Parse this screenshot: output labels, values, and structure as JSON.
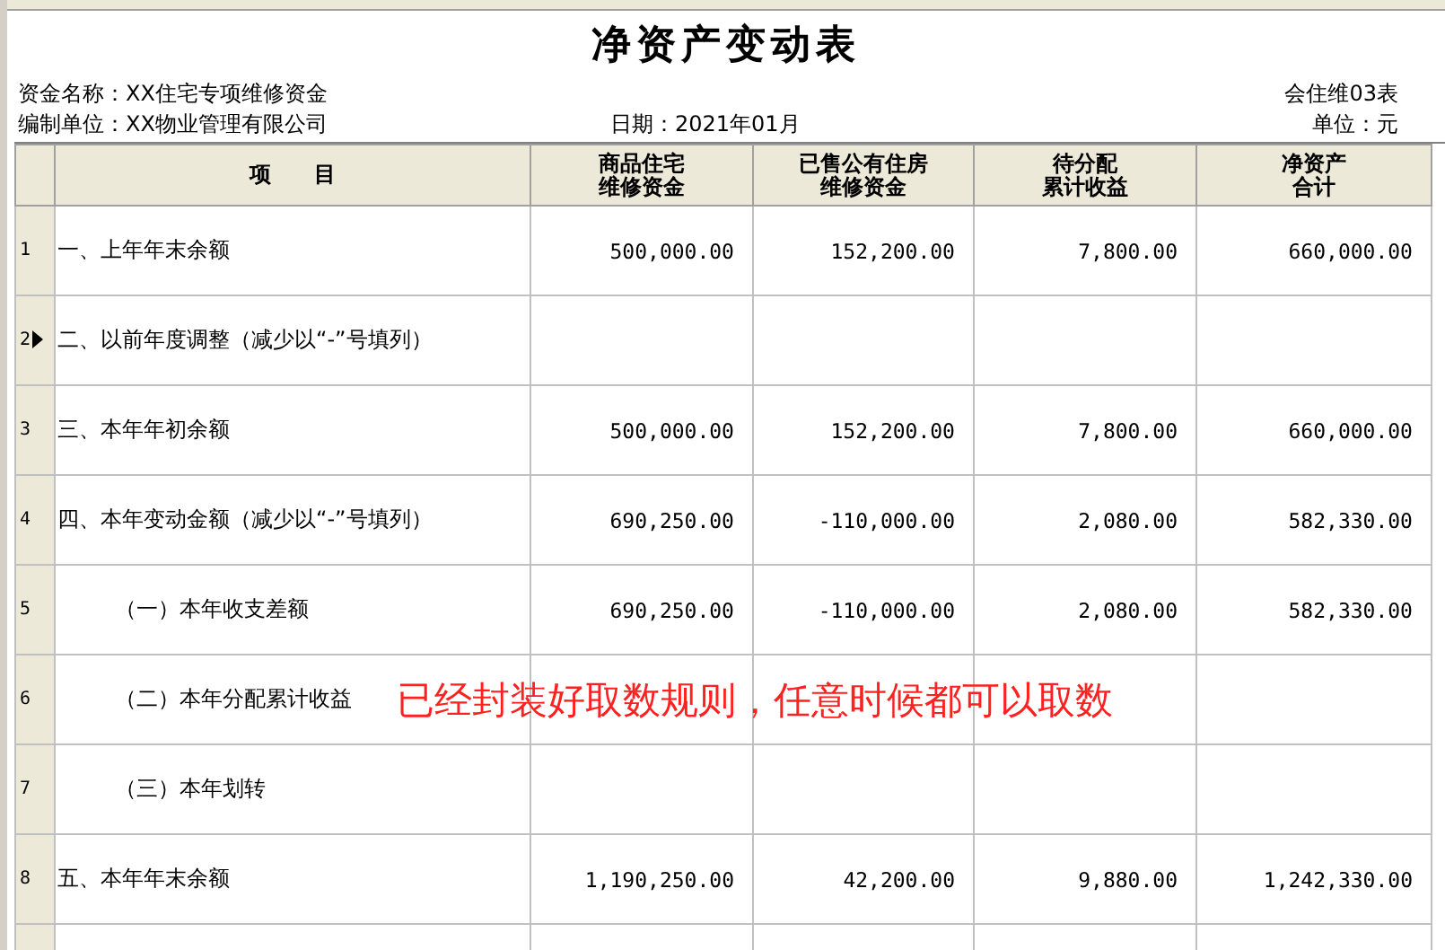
{
  "title": "净资产变动表",
  "info": {
    "fund_name": "资金名称：XX住宅专项维修资金",
    "form_code": "会住维03表",
    "unit_name": "编制单位：XX物业管理有限公司",
    "date": "日期：2021年01月",
    "currency_unit": "单位：元"
  },
  "table": {
    "columns": [
      {
        "lines": [
          "项　　目"
        ]
      },
      {
        "lines": [
          "商品住宅",
          "维修资金"
        ]
      },
      {
        "lines": [
          "已售公有住房",
          "维修资金"
        ]
      },
      {
        "lines": [
          "待分配",
          "累计收益"
        ]
      },
      {
        "lines": [
          "净资产",
          "合计"
        ]
      }
    ],
    "rows": [
      {
        "number": "1",
        "item": "一、上年年末余额",
        "values": [
          "500,000.00",
          "152,200.00",
          "7,800.00",
          "660,000.00"
        ],
        "selected": false
      },
      {
        "number": "2",
        "item": "二、以前年度调整（减少以“-”号填列）",
        "selected": true
      },
      {
        "number": "3",
        "item": "三、本年年初余额",
        "values": [
          "500,000.00",
          "152,200.00",
          "7,800.00",
          "660,000.00"
        ],
        "selected": false
      },
      {
        "number": "4",
        "item": "四、本年变动金额（减少以“-”号填列）",
        "values": [
          "690,250.00",
          "-110,000.00",
          "2,080.00",
          "582,330.00"
        ],
        "selected": false,
        "children": [
          {
            "number": "5",
            "item": "（一）本年收支差额",
            "values": [
              "690,250.00",
              "-110,000.00",
              "2,080.00",
              "582,330.00"
            ],
            "selected": false
          },
          {
            "number": "6",
            "item": "（二）本年分配累计收益",
            "selected": false
          },
          {
            "number": "7",
            "item": "（三）本年划转",
            "selected": false
          }
        ]
      },
      {
        "number": "8",
        "item": "五、本年年末余额",
        "values": [
          "1,190,250.00",
          "42,200.00",
          "9,880.00",
          "1,242,330.00"
        ],
        "selected": false
      }
    ]
  },
  "annotation": "已经封装好取数规则，任意时候都可以取数"
}
